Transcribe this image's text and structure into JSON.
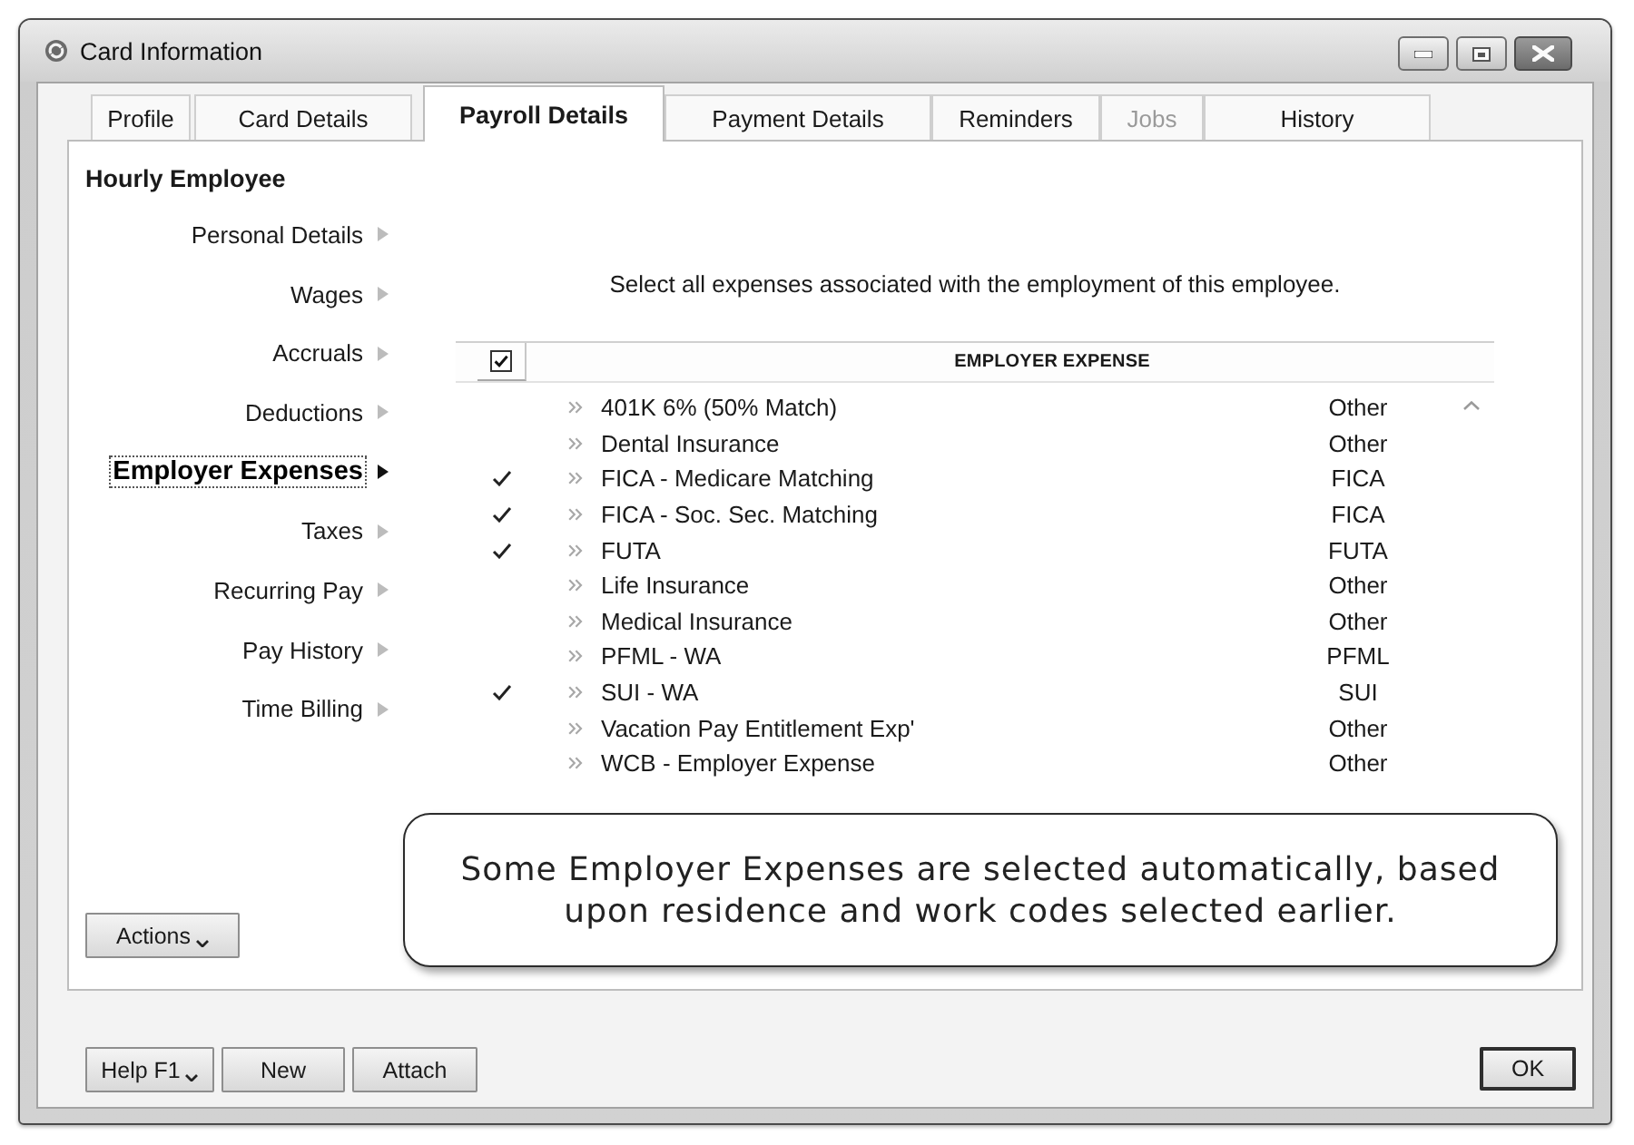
{
  "window": {
    "title": "Card Information"
  },
  "tabs": [
    {
      "label": "Profile",
      "selected": false,
      "disabled": false
    },
    {
      "label": "Card Details",
      "selected": false,
      "disabled": false
    },
    {
      "label": "Payroll Details",
      "selected": true,
      "disabled": false
    },
    {
      "label": "Payment Details",
      "selected": false,
      "disabled": false
    },
    {
      "label": "Reminders",
      "selected": false,
      "disabled": false
    },
    {
      "label": "Jobs",
      "selected": false,
      "disabled": true
    },
    {
      "label": "History",
      "selected": false,
      "disabled": false
    }
  ],
  "panel": {
    "heading": "Hourly Employee"
  },
  "sidebar": {
    "items": [
      {
        "label": "Personal Details",
        "selected": false
      },
      {
        "label": "Wages",
        "selected": false
      },
      {
        "label": "Accruals",
        "selected": false
      },
      {
        "label": "Deductions",
        "selected": false
      },
      {
        "label": "Employer Expenses",
        "selected": true
      },
      {
        "label": "Taxes",
        "selected": false
      },
      {
        "label": "Recurring Pay",
        "selected": false
      },
      {
        "label": "Pay History",
        "selected": false
      },
      {
        "label": "Time Billing",
        "selected": false
      }
    ]
  },
  "expenses": {
    "instruction": "Select all expenses associated with the employment of this employee.",
    "header": {
      "label": "EMPLOYER EXPENSE",
      "checked": true
    },
    "rows": [
      {
        "name": "401K 6% (50% Match)",
        "type": "Other",
        "checked": false
      },
      {
        "name": "Dental Insurance",
        "type": "Other",
        "checked": false
      },
      {
        "name": "FICA - Medicare Matching",
        "type": "FICA",
        "checked": true
      },
      {
        "name": "FICA - Soc. Sec. Matching",
        "type": "FICA",
        "checked": true
      },
      {
        "name": "FUTA",
        "type": "FUTA",
        "checked": true
      },
      {
        "name": "Life Insurance",
        "type": "Other",
        "checked": false
      },
      {
        "name": "Medical Insurance",
        "type": "Other",
        "checked": false
      },
      {
        "name": "PFML - WA",
        "type": "PFML",
        "checked": false
      },
      {
        "name": "SUI - WA",
        "type": "SUI",
        "checked": true
      },
      {
        "name": "Vacation Pay Entitlement Exp'",
        "type": "Other",
        "checked": false
      },
      {
        "name": "WCB - Employer Expense",
        "type": "Other",
        "checked": false
      }
    ]
  },
  "actions_button": {
    "label": "Actions",
    "kind": "dropdown"
  },
  "callout": {
    "text": "Some Employer Expenses are selected automatically, based upon residence and work codes selected earlier."
  },
  "footer": {
    "buttons": [
      {
        "label": "Help F1",
        "kind": "dropdown"
      },
      {
        "label": "New",
        "kind": "plain"
      },
      {
        "label": "Attach",
        "kind": "plain"
      }
    ],
    "ok_button": {
      "label": "OK",
      "kind": "default"
    }
  }
}
